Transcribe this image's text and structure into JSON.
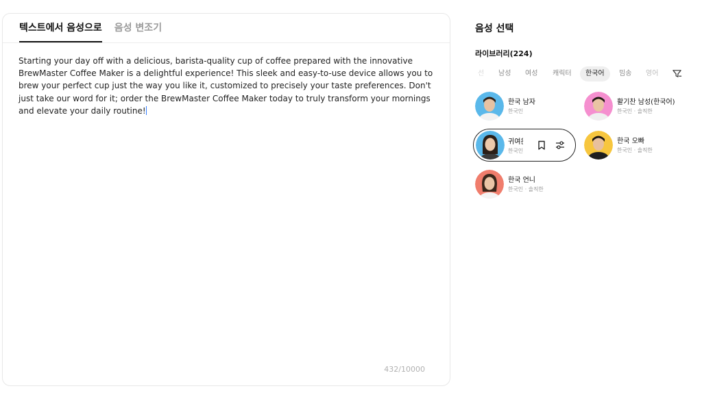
{
  "editor": {
    "tabs": [
      {
        "label": "텍스트에서 음성으로"
      },
      {
        "label": "음성 변조기"
      }
    ],
    "text": "Starting your day off with a delicious, barista-quality cup of coffee prepared with the innovative BrewMaster Coffee Maker is a delightful experience! This sleek and easy-to-use device allows you to brew your perfect cup just the way you like it, customized to precisely your taste preferences. Don't just take our word for it; order the BrewMaster Coffee Maker today to truly transform your mornings and elevate your daily routine!",
    "char_count": "432/10000"
  },
  "voice_panel": {
    "title": "음성 선택",
    "library_label": "라이브러리(224)",
    "filters": [
      {
        "label": "선"
      },
      {
        "label": "남성"
      },
      {
        "label": "여성"
      },
      {
        "label": "캐릭터"
      },
      {
        "label": "한국어"
      },
      {
        "label": "밈송"
      },
      {
        "label": "영어"
      }
    ],
    "selected_filter": "한국어",
    "voices": [
      {
        "name": "한국 남자",
        "sub": "한국인"
      },
      {
        "name": "활기찬 남성(한국어)",
        "sub": "한국인 · 솔직한"
      },
      {
        "name": "귀여운",
        "sub": "한국인"
      },
      {
        "name": "한국 오빠",
        "sub": "한국인 · 솔직한"
      },
      {
        "name": "한국 언니",
        "sub": "한국인 · 솔직한"
      }
    ]
  },
  "colors": {
    "caret": "#2f7bff",
    "avatar_blue": "#5ab8ea",
    "avatar_pink": "#f58fcf",
    "avatar_yellow": "#f7c63e",
    "avatar_coral": "#f07d6c"
  }
}
